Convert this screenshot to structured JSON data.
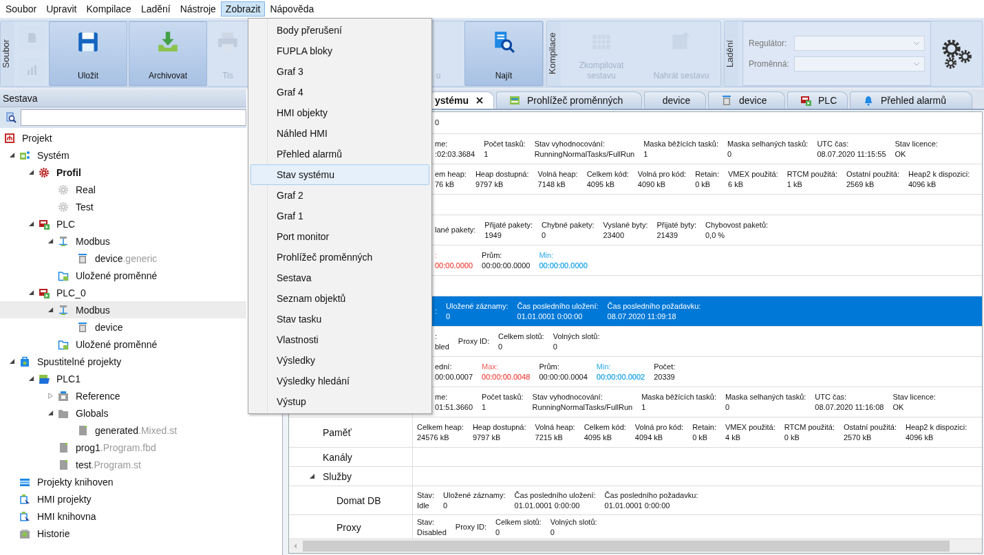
{
  "menubar": [
    {
      "label": "Soubor",
      "selected": false
    },
    {
      "label": "Upravit",
      "selected": false
    },
    {
      "label": "Kompilace",
      "selected": false
    },
    {
      "label": "Ladění",
      "selected": false
    },
    {
      "label": "Nástroje",
      "selected": false
    },
    {
      "label": "Zobrazit",
      "selected": true
    },
    {
      "label": "Nápověda",
      "selected": false
    }
  ],
  "ribbon": {
    "groups": [
      {
        "label": "Soubor",
        "small_buttons": [
          {
            "kind": "doc",
            "disabled": true
          },
          {
            "kind": "chart",
            "disabled": true
          }
        ],
        "buttons": [
          {
            "label": "Uložit",
            "kind": "save",
            "disabled": false
          },
          {
            "label": "Archivovat",
            "kind": "archive",
            "disabled": false
          },
          {
            "label": "Tis",
            "kind": "print",
            "disabled": true
          }
        ]
      },
      {
        "buttons": [
          {
            "label": "u",
            "kind": "plain",
            "disabled": true
          },
          {
            "label": "Najít",
            "kind": "find",
            "disabled": false
          }
        ]
      },
      {
        "label": "Kompilace",
        "buttons": [
          {
            "label": "Zkompilovat sestavu",
            "kind": "compile",
            "disabled": true
          },
          {
            "label": "Nahrát sestavu",
            "kind": "upload",
            "disabled": true
          }
        ]
      }
    ],
    "debug": {
      "label": "Ladění",
      "fields": [
        {
          "label": "Regulátor:",
          "disabled": true
        },
        {
          "label": "Proměnná:",
          "disabled": true
        }
      ]
    }
  },
  "sidebar": {
    "title": "Sestava",
    "tree": [
      {
        "label": "Projekt",
        "kind": "project",
        "selected": false,
        "active": false,
        "children": [
          {
            "label": "Systém",
            "kind": "system",
            "selected": false,
            "active": false,
            "expanded": true,
            "children": [
              {
                "label": "Profil",
                "kind": "profile",
                "selected": false,
                "active": true,
                "expanded": true,
                "children": [
                  {
                    "label": "Real",
                    "kind": "gear",
                    "selected": false,
                    "active": false
                  },
                  {
                    "label": "Test",
                    "kind": "gear",
                    "selected": false,
                    "active": false
                  }
                ]
              },
              {
                "label": "PLC",
                "kind": "plc",
                "selected": false,
                "active": false,
                "expanded": true,
                "children": [
                  {
                    "label": "Modbus",
                    "kind": "modbus",
                    "selected": false,
                    "active": false,
                    "expanded": true,
                    "children": [
                      {
                        "label": "device",
                        "suffix": ".generic",
                        "kind": "device",
                        "selected": false,
                        "active": false
                      }
                    ]
                  },
                  {
                    "label": "Uložené proměnné",
                    "kind": "saved",
                    "selected": false,
                    "active": false
                  }
                ]
              },
              {
                "label": "PLC_0",
                "kind": "plc",
                "selected": false,
                "active": false,
                "expanded": true,
                "children": [
                  {
                    "label": "Modbus",
                    "kind": "modbus",
                    "selected": true,
                    "active": false,
                    "expanded": true,
                    "children": [
                      {
                        "label": "device",
                        "kind": "device",
                        "selected": false,
                        "active": false
                      }
                    ]
                  },
                  {
                    "label": "Uložené proměnné",
                    "kind": "saved",
                    "selected": false,
                    "active": false
                  }
                ]
              }
            ]
          },
          {
            "label": "Spustitelné projekty",
            "kind": "runproj",
            "selected": false,
            "active": false,
            "expanded": true,
            "children": [
              {
                "label": "PLC1",
                "kind": "folderopen",
                "selected": false,
                "active": false,
                "expanded": true,
                "children": [
                  {
                    "label": "Reference",
                    "kind": "reference",
                    "selected": false,
                    "active": false,
                    "expanded": false
                  },
                  {
                    "label": "Globals",
                    "kind": "folder",
                    "selected": false,
                    "active": false,
                    "expanded": true,
                    "children": [
                      {
                        "label": "generated",
                        "suffix": ".Mixed.st",
                        "kind": "file",
                        "selected": false,
                        "active": false
                      }
                    ]
                  },
                  {
                    "label": "prog1",
                    "suffix": ".Program.fbd",
                    "kind": "file",
                    "selected": false,
                    "active": false
                  },
                  {
                    "label": "test",
                    "suffix": ".Program.st",
                    "kind": "file",
                    "selected": false,
                    "active": false
                  }
                ]
              }
            ]
          },
          {
            "label": "Projekty knihoven",
            "kind": "library",
            "selected": false,
            "active": false
          },
          {
            "label": "HMI projekty",
            "kind": "hmi",
            "selected": false,
            "active": false
          },
          {
            "label": "HMI knihovna",
            "kind": "hmi",
            "selected": false,
            "active": false
          },
          {
            "label": "Historie",
            "kind": "history",
            "selected": false,
            "active": false
          }
        ]
      }
    ]
  },
  "tabs": [
    {
      "label": "ystému",
      "kind": "plain",
      "selected": true
    },
    {
      "label": "Prohlížeč proměnných",
      "kind": "vars",
      "selected": false
    },
    {
      "label": "device",
      "kind": "plain",
      "selected": false
    },
    {
      "label": "device",
      "kind": "device",
      "selected": false
    },
    {
      "label": "PLC",
      "kind": "plc",
      "selected": false
    },
    {
      "label": "Přehled alarmů",
      "kind": "alarm",
      "selected": false
    }
  ],
  "status": {
    "rows": [
      {
        "selected": false,
        "cells": [
          {
            "label": "0"
          }
        ]
      },
      {
        "selected": false,
        "cells": [
          {
            "label": "me:",
            "value": ":02:03.3684"
          },
          {
            "label": "Počet tasků:",
            "value": "1"
          },
          {
            "label": "Stav vyhodnocování:",
            "value": "RunningNormalTasks/FullRun"
          },
          {
            "label": "Maska běžících tasků:",
            "value": "1"
          },
          {
            "label": "Maska selhaných tasků:",
            "value": "0"
          },
          {
            "label": "UTC čas:",
            "value": "08.07.2020 11:15:55"
          },
          {
            "label": "Stav licence:",
            "value": "OK"
          }
        ]
      },
      {
        "selected": false,
        "cells": [
          {
            "label": "em heap:",
            "value": "76 kB"
          },
          {
            "label": "Heap dostupná:",
            "value": "9797 kB"
          },
          {
            "label": "Volná heap:",
            "value": "7148 kB"
          },
          {
            "label": "Celkem kód:",
            "value": "4095 kB"
          },
          {
            "label": "Volná pro kód:",
            "value": "4090 kB"
          },
          {
            "label": "Retain:",
            "value": "0 kB"
          },
          {
            "label": "VMEX použitá:",
            "value": "6 kB"
          },
          {
            "label": "RTCM použitá:",
            "value": "1 kB"
          },
          {
            "label": "Ostatní použitá:",
            "value": "2569 kB"
          },
          {
            "label": "Heap2 k dispozici:",
            "value": "4096 kB"
          }
        ]
      },
      {},
      {
        "selected": false,
        "cells": [
          {
            "label": "lané pakety:"
          },
          {
            "label": "Přijaté pakety:",
            "value": "1949"
          },
          {
            "label": "Chybné pakety:",
            "value": "0"
          },
          {
            "label": "Vyslané byty:",
            "value": "23400"
          },
          {
            "label": "Přijaté byty:",
            "value": "21439"
          },
          {
            "label": "Chybovost paketů:",
            "value": "0,0 %"
          }
        ]
      },
      {
        "selected": false,
        "cells": [
          {
            "label": ":",
            "value": "00:00.0000",
            "color": "#f0605a"
          },
          {
            "label": "Prům:",
            "value": "00:00:00.0000"
          },
          {
            "label": "Min:",
            "value": "00:00:00.0000",
            "color": "#2aa9e8"
          }
        ]
      },
      {},
      {
        "selected": true,
        "cells": [
          {
            "label": ":"
          },
          {
            "label": "Uložené záznamy:",
            "value": "0"
          },
          {
            "label": "Čas posledního uložení:",
            "value": "01.01.0001 0:00:00"
          },
          {
            "label": "Čas posledního požadavku:",
            "value": "08.07.2020 11:09:18"
          }
        ]
      },
      {
        "selected": false,
        "cells": [
          {
            "label": ":",
            "value": "bled"
          },
          {
            "label": "Proxy ID:"
          },
          {
            "label": "Celkem slotů:",
            "value": "0"
          },
          {
            "label": "Volných slotů:",
            "value": "0"
          }
        ]
      },
      {
        "selected": false,
        "cells": [
          {
            "label": "ední:",
            "value": "00:00.0007"
          },
          {
            "label": "Max:",
            "value": "00:00:00.0048",
            "color": "#f0605a"
          },
          {
            "label": "Prům:",
            "value": "00:00:00.0004"
          },
          {
            "label": "Min:",
            "value": "00:00:00.0002",
            "color": "#2aa9e8"
          },
          {
            "label": "Počet:",
            "value": "20339"
          }
        ]
      },
      {
        "selected": false,
        "cells": [
          {
            "label": "me:",
            "value": "01:51.3660"
          },
          {
            "label": "Počet tasků:",
            "value": "1"
          },
          {
            "label": "Stav vyhodnocování:",
            "value": "RunningNormalTasks/FullRun"
          },
          {
            "label": "Maska běžících tasků:",
            "value": "1"
          },
          {
            "label": "Maska selhaných tasků:",
            "value": "0"
          },
          {
            "label": "UTC čas:",
            "value": "08.07.2020 11:16:08"
          },
          {
            "label": "Stav licence:",
            "value": "OK"
          }
        ]
      },
      {
        "name": "Paměť",
        "selected": false,
        "cells": [
          {
            "label": "Celkem heap:",
            "value": "24576 kB"
          },
          {
            "label": "Heap dostupná:",
            "value": "9797 kB"
          },
          {
            "label": "Volná heap:",
            "value": "7215 kB"
          },
          {
            "label": "Celkem kód:",
            "value": "4095 kB"
          },
          {
            "label": "Volná pro kód:",
            "value": "4094 kB"
          },
          {
            "label": "Retain:",
            "value": "0 kB"
          },
          {
            "label": "VMEX použitá:",
            "value": "4 kB"
          },
          {
            "label": "RTCM použitá:",
            "value": "0 kB"
          },
          {
            "label": "Ostatní použitá:",
            "value": "2570 kB"
          },
          {
            "label": "Heap2 k dispozici:",
            "value": "4096 kB"
          }
        ]
      },
      {
        "name": "Kanály",
        "selected": false
      },
      {
        "name": "Služby",
        "selected": false,
        "expanded": true,
        "children": [
          {
            "name": "Domat DB",
            "selected": false,
            "cells": [
              {
                "label": "Stav:",
                "value": "Idle"
              },
              {
                "label": "Uložené záznamy:",
                "value": "0"
              },
              {
                "label": "Čas posledního uložení:",
                "value": "01.01.0001 0:00:00"
              },
              {
                "label": "Čas posledního požadavku:",
                "value": "01.01.0001 0:00:00"
              }
            ]
          },
          {
            "name": "Proxy",
            "selected": false,
            "cells": [
              {
                "label": "Stav:",
                "value": "Disabled"
              },
              {
                "label": "Proxy ID:"
              },
              {
                "label": "Celkem slotů:",
                "value": "0"
              },
              {
                "label": "Volných slotů:",
                "value": "0"
              }
            ]
          }
        ]
      }
    ]
  },
  "view_menu": {
    "items": [
      {
        "label": "Body přerušení",
        "selected": false
      },
      {
        "label": "FUPLA bloky",
        "selected": false
      },
      {
        "label": "Graf 3",
        "selected": false
      },
      {
        "label": "Graf 4",
        "selected": false
      },
      {
        "label": "HMI objekty",
        "selected": false
      },
      {
        "label": "Náhled HMI",
        "selected": false
      },
      {
        "label": "Přehled alarmů",
        "selected": false
      },
      {
        "label": "Stav systému",
        "selected": true
      },
      {
        "label": "Graf 2",
        "selected": false
      },
      {
        "label": "Graf 1",
        "selected": false
      },
      {
        "label": "Port monitor",
        "selected": false
      },
      {
        "label": "Prohlížeč proměnných",
        "selected": false
      },
      {
        "label": "Sestava",
        "selected": false
      },
      {
        "label": "Seznam objektů",
        "selected": false
      },
      {
        "label": "Stav tasku",
        "selected": false
      },
      {
        "label": "Vlastnosti",
        "selected": false
      },
      {
        "label": "Výsledky",
        "selected": false
      },
      {
        "label": "Výsledky hledání",
        "selected": false
      },
      {
        "label": "Výstup",
        "selected": false
      }
    ]
  }
}
